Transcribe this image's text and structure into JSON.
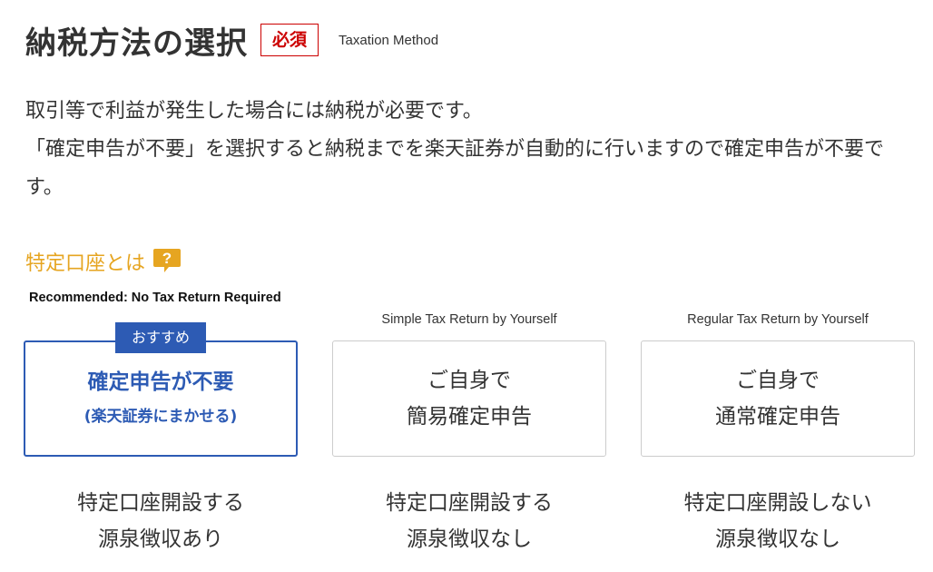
{
  "header": {
    "title": "納税方法の選択",
    "required_badge": "必須",
    "title_en": "Taxation Method"
  },
  "description": {
    "lines": [
      "取引等で利益が発生した場合には納税が必要です。",
      "「確定申告が不要」を選択すると納税までを楽天証券が自動的に行いますので確定申告が不要です。"
    ]
  },
  "help_link": {
    "label": "特定口座とは",
    "icon": "question-icon",
    "icon_color": "#e6a521"
  },
  "options": [
    {
      "caption": "Recommended: No Tax Return Required",
      "tag": "おすすめ",
      "card_line1": "確定申告が不要",
      "card_line2": "(楽天証券にまかせる)",
      "result_line1": "特定口座開設する",
      "result_line2": "源泉徴収あり",
      "selected": true
    },
    {
      "caption": "Simple Tax Return by Yourself",
      "card_line1": "ご自身で",
      "card_line2": "簡易確定申告",
      "result_line1": "特定口座開設する",
      "result_line2": "源泉徴収なし",
      "selected": false
    },
    {
      "caption": "Regular Tax Return by Yourself",
      "card_line1": "ご自身で",
      "card_line2": "通常確定申告",
      "result_line1": "特定口座開設しない",
      "result_line2": "源泉徴収なし",
      "selected": false
    }
  ],
  "colors": {
    "accent_blue": "#2d5bb4",
    "required_red": "#cc0000",
    "help_orange": "#e6a521",
    "text": "#333333",
    "card_border": "#cccccc"
  }
}
